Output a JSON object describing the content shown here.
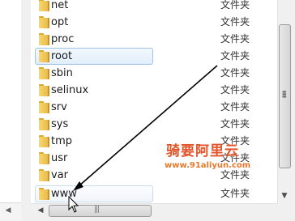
{
  "files": [
    {
      "name": "net",
      "type": "文件夹"
    },
    {
      "name": "opt",
      "type": "文件夹"
    },
    {
      "name": "proc",
      "type": "文件夹"
    },
    {
      "name": "root",
      "type": "文件夹"
    },
    {
      "name": "sbin",
      "type": "文件夹"
    },
    {
      "name": "selinux",
      "type": "文件夹"
    },
    {
      "name": "srv",
      "type": "文件夹"
    },
    {
      "name": "sys",
      "type": "文件夹"
    },
    {
      "name": "tmp",
      "type": "文件夹"
    },
    {
      "name": "usr",
      "type": "文件夹"
    },
    {
      "name": "var",
      "type": "文件夹"
    },
    {
      "name": "www",
      "type": "文件夹"
    }
  ],
  "selected_row": "root",
  "watermark": {
    "brand": "骑要阿里云",
    "url": "www.91aliyun.com"
  },
  "icons": {
    "folder": "folder-icon",
    "scroll_left": "scroll-left-arrow-icon",
    "scroll_down": "scroll-down-arrow-icon",
    "cursor": "mouse-pointer-icon"
  },
  "colors": {
    "selection_border": "#9fc2e8",
    "folder": "#f6d774",
    "watermark": "#e2542a",
    "arrow": "#000000"
  }
}
